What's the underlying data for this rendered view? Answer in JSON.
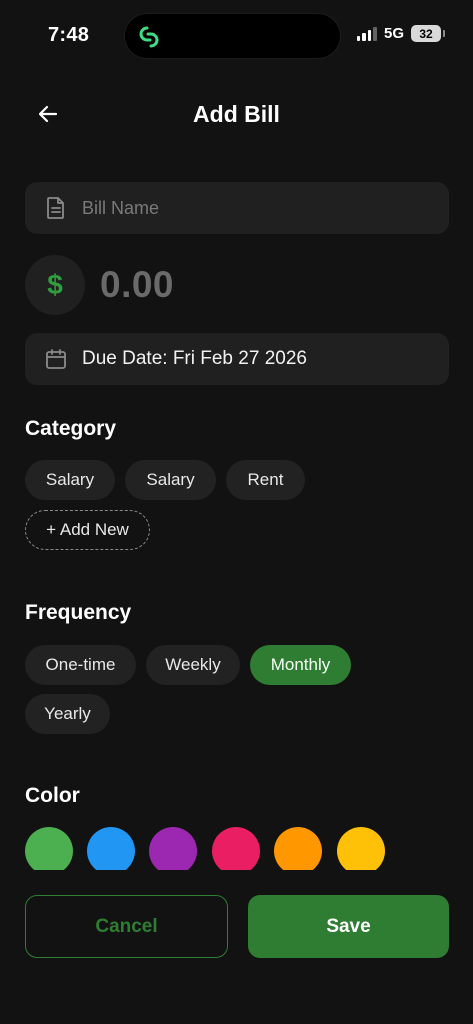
{
  "status_bar": {
    "time": "7:48",
    "network": "5G",
    "battery": "32"
  },
  "header": {
    "title": "Add Bill"
  },
  "form": {
    "bill_name_placeholder": "Bill Name",
    "bill_name_value": "",
    "currency_symbol": "$",
    "amount": "0.00",
    "due_date": "Due Date: Fri Feb 27 2026"
  },
  "category": {
    "title": "Category",
    "chips": [
      "Salary",
      "Salary",
      "Rent"
    ],
    "add_new_label": "+ Add New"
  },
  "frequency": {
    "title": "Frequency",
    "options": [
      "One-time",
      "Weekly",
      "Monthly",
      "Yearly"
    ],
    "selected": "Monthly"
  },
  "color": {
    "title": "Color",
    "swatches": [
      "#4caf50",
      "#2196f3",
      "#9c27b0",
      "#e91e63",
      "#ff9800",
      "#ffc107"
    ]
  },
  "actions": {
    "cancel_label": "Cancel",
    "save_label": "Save"
  },
  "theme": {
    "accent": "#2e7d32",
    "background": "#121212",
    "surface": "#202020"
  }
}
